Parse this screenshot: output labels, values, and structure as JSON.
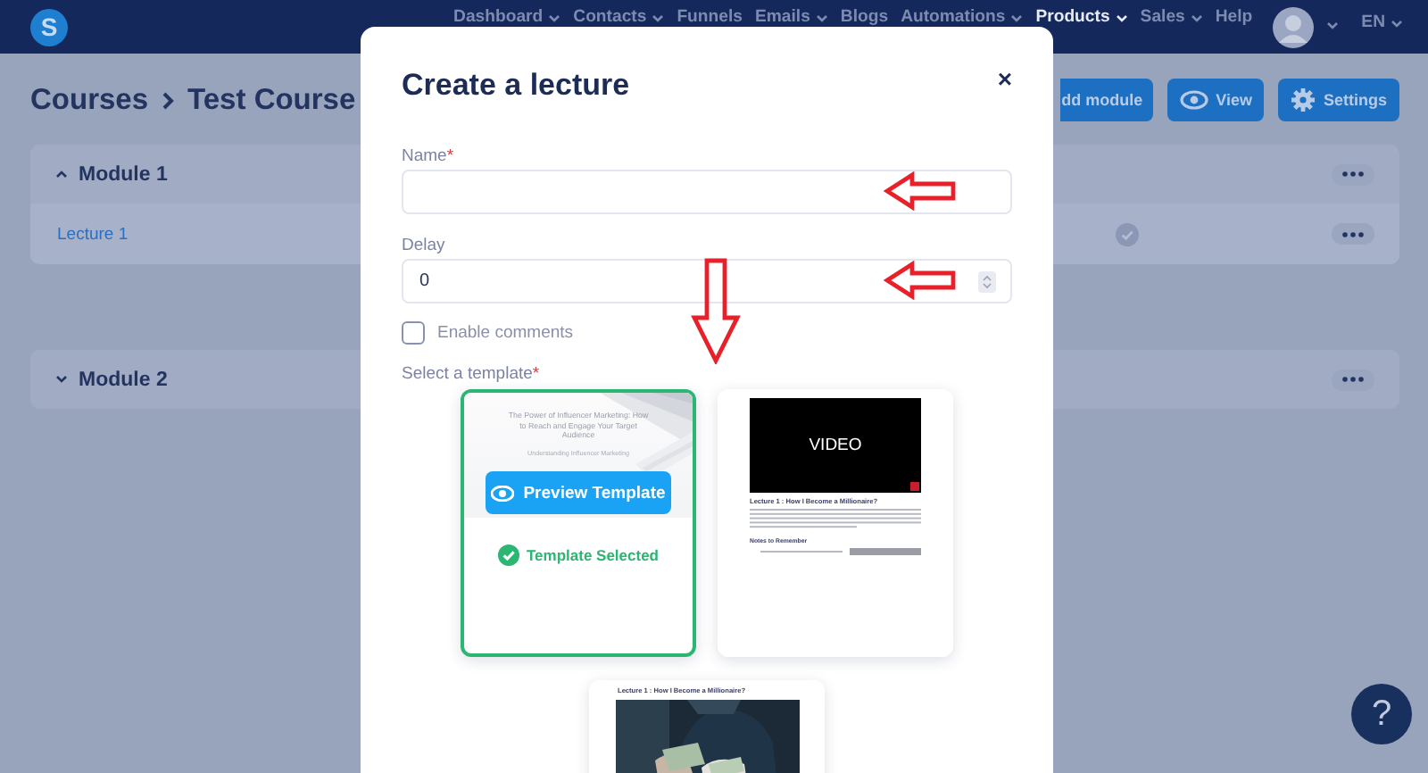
{
  "nav": {
    "logo": "S",
    "items": [
      {
        "label": "Dashboard",
        "dropdown": true,
        "selected": false
      },
      {
        "label": "Contacts",
        "dropdown": true,
        "selected": false
      },
      {
        "label": "Funnels",
        "dropdown": false,
        "selected": false
      },
      {
        "label": "Emails",
        "dropdown": true,
        "selected": false
      },
      {
        "label": "Blogs",
        "dropdown": false,
        "selected": false
      },
      {
        "label": "Automations",
        "dropdown": true,
        "selected": false
      },
      {
        "label": "Products",
        "dropdown": true,
        "selected": true
      },
      {
        "label": "Sales",
        "dropdown": true,
        "selected": false
      },
      {
        "label": "Help",
        "dropdown": false,
        "selected": false
      }
    ],
    "language": "EN"
  },
  "page": {
    "breadcrumb": [
      "Courses",
      "Test Course"
    ],
    "buttons": [
      {
        "label": "dd module",
        "kind": "plain"
      },
      {
        "label": "View",
        "kind": "view"
      },
      {
        "label": "Settings",
        "kind": "settings"
      }
    ],
    "modules": [
      {
        "title": "Module 1",
        "expanded": true,
        "lectures": [
          {
            "title": "Lecture 1",
            "published": true
          }
        ]
      },
      {
        "title": "Module 2",
        "expanded": false
      }
    ]
  },
  "modal": {
    "title": "Create a lecture",
    "close": "×",
    "fields": [
      {
        "label": "Name",
        "required_mark": "*",
        "kind": "text",
        "annotated": true
      },
      {
        "label": "Delay",
        "value": "0",
        "kind": "number",
        "annotated": true
      }
    ],
    "checkbox": {
      "label": "Enable comments",
      "checked": false
    },
    "template_label": "Select a template",
    "template_required_mark": "*",
    "templates_annotated": true,
    "templates": [
      {
        "kind": "document",
        "selected": true,
        "title": "The Power of Influencer Marketing: How to Reach and Engage Your Target Audience",
        "subtitle": "Understanding Influencer Marketing",
        "preview_button": "Preview Template",
        "selected_label": "Template Selected"
      },
      {
        "kind": "video",
        "selected": false,
        "video_label": "VIDEO",
        "title": "Lecture 1 : How I Become a Millionaire?",
        "notes_heading": "Notes to Remember"
      },
      {
        "selected": false,
        "title": "Lecture 1 : How I Become a Millionaire?"
      }
    ]
  },
  "help_button": "?"
}
